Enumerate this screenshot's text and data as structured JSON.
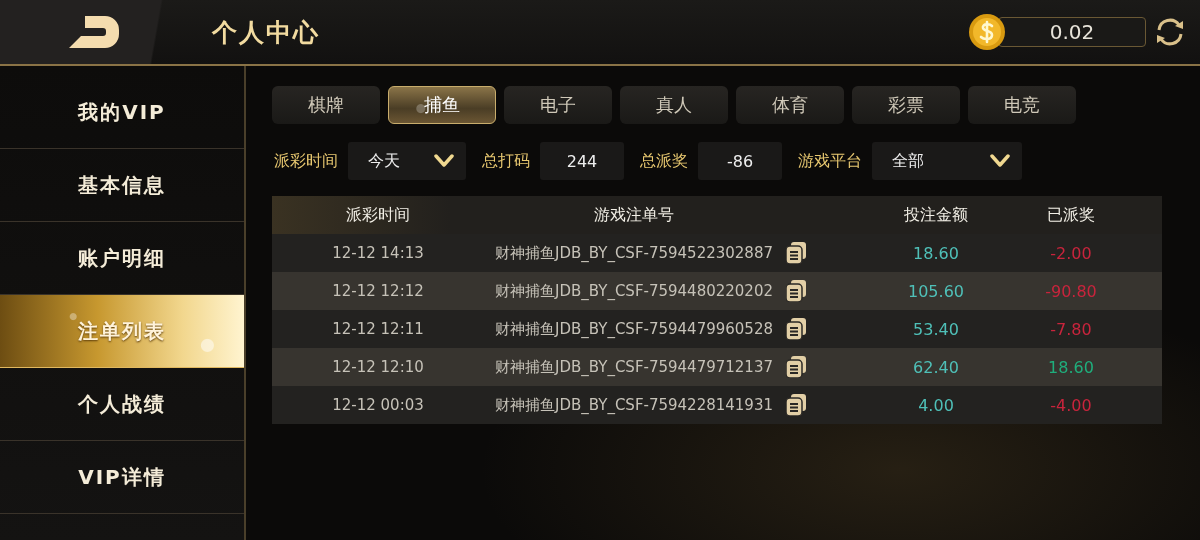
{
  "header": {
    "title": "个人中心",
    "balance": "0.02"
  },
  "sidebar": {
    "items": [
      {
        "label": "我的VIP",
        "selected": false
      },
      {
        "label": "基本信息",
        "selected": false
      },
      {
        "label": "账户明细",
        "selected": false
      },
      {
        "label": "注单列表",
        "selected": true
      },
      {
        "label": "个人战绩",
        "selected": false
      },
      {
        "label": "VIP详情",
        "selected": false
      }
    ]
  },
  "tabs": [
    {
      "label": "棋牌",
      "selected": false
    },
    {
      "label": "捕鱼",
      "selected": true
    },
    {
      "label": "电子",
      "selected": false
    },
    {
      "label": "真人",
      "selected": false
    },
    {
      "label": "体育",
      "selected": false
    },
    {
      "label": "彩票",
      "selected": false
    },
    {
      "label": "电竞",
      "selected": false
    }
  ],
  "filters": [
    {
      "kind": "dropdown",
      "label": "派彩时间",
      "value": "今天"
    },
    {
      "kind": "readout",
      "label": "总打码",
      "value": "244"
    },
    {
      "kind": "readout",
      "label": "总派奖",
      "value": "-86"
    },
    {
      "kind": "dropdown",
      "label": "游戏平台",
      "value": "全部"
    }
  ],
  "table": {
    "columns": [
      "派彩时间",
      "游戏注单号",
      "投注金额",
      "已派奖"
    ],
    "rows": [
      {
        "time": "12-12 14:13",
        "order_id": "财神捕鱼JDB_BY_CSF-7594522302887",
        "amount": "18.60",
        "payout": {
          "text": "-2.00",
          "color": "#c8243c"
        }
      },
      {
        "time": "12-12 12:12",
        "order_id": "财神捕鱼JDB_BY_CSF-7594480220202",
        "amount": "105.60",
        "payout": {
          "text": "-90.80",
          "color": "#c8243c"
        }
      },
      {
        "time": "12-12 12:11",
        "order_id": "财神捕鱼JDB_BY_CSF-7594479960528",
        "amount": "53.40",
        "payout": {
          "text": "-7.80",
          "color": "#c8243c"
        }
      },
      {
        "time": "12-12 12:10",
        "order_id": "财神捕鱼JDB_BY_CSF-7594479712137",
        "amount": "62.40",
        "payout": {
          "text": "18.60",
          "color": "#1fae7c"
        }
      },
      {
        "time": "12-12 00:03",
        "order_id": "财神捕鱼JDB_BY_CSF-7594228141931",
        "amount": "4.00",
        "payout": {
          "text": "-4.00",
          "color": "#c8243c"
        }
      }
    ]
  }
}
